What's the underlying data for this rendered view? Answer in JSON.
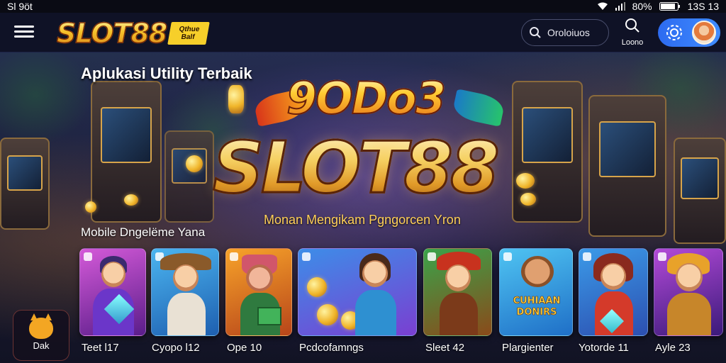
{
  "status_bar": {
    "time": "Sl 9öt",
    "battery": "80%",
    "clock": "13S 13"
  },
  "header": {
    "logo_text": "SLOT88",
    "logo_badge": "Qthue Balf",
    "search_label": "Oroloiuos",
    "nav_item_label": "Loono"
  },
  "hero": {
    "title": "Aplukasi Utility Terbaik",
    "mascot_text": "9ODo3",
    "big_logo": "SLOT88",
    "tagline": "Monan Mengikam Pgngorcen Yron",
    "section_title": "Mobile Dngelëme Yana"
  },
  "games": [
    {
      "label": "Teet l17"
    },
    {
      "label": "Cyopo l12"
    },
    {
      "label": "Ope 10"
    },
    {
      "label": "Pcdcofamngs"
    },
    {
      "label": "Sleet 42"
    },
    {
      "label": "Plargienter",
      "art_text": "CUHIAAN DONIRS"
    },
    {
      "label": "Yotorde 11"
    },
    {
      "label": "Ayle 23"
    }
  ],
  "floating_button": {
    "label": "Dak"
  },
  "colors": {
    "accent_blue": "#3f8cff",
    "gold": "#f6c22a",
    "bg": "#0d1024"
  }
}
